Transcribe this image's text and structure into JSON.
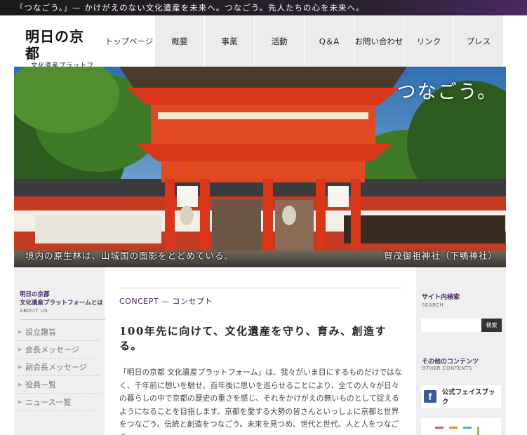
{
  "topbar": {
    "text": "「つなごう。」— かけがえのない文化遺産を未来へ。つなごう。先人たちの心を未来へ。"
  },
  "logo": {
    "main": "明日の京都",
    "sub": "文化遺産プラットフォーム"
  },
  "nav": {
    "home": "トップページ",
    "items": [
      "概要",
      "事業",
      "活動",
      "Q＆A",
      "お問い合わせ",
      "リンク",
      "プレス"
    ]
  },
  "hero": {
    "tagline": "つなごう。",
    "caption_left": "境内の原生林は、山城国の面影をとどめている。",
    "caption_right": "賀茂御祖神社（下鴨神社）"
  },
  "left_sidebar": {
    "title_line1": "明日の京都",
    "title_line2": "文化遺産プラットフォームとは",
    "subtitle": "ABOUT US",
    "items": [
      "設立趣旨",
      "会長メッセージ",
      "副会長メッセージ",
      "役員一覧",
      "ニュース一覧"
    ]
  },
  "main": {
    "section_label": "CONCEPT — コンセプト",
    "headline": "100年先に向けて、文化遺産を守り、育み、創造する。",
    "body": "「明日の京都 文化遺産プラットフォーム」は、我々がいま目にするものだけではなく、千年前に想いを馳せ、百年後に思いを巡らせることにより、全ての人々が日々の暮らしの中で京都の歴史の重さを感じ、それをかけがえの無いものとして捉えるようになることを目指します。京都を愛する大勢の皆さんといっしょに京都と世界をつなごう。伝統と創造をつなごう。未来を見つめ、世代と世代、人と人をつなごう。"
  },
  "right_sidebar": {
    "search_title": "サイト内検索",
    "search_sub": "SEARCH",
    "search_placeholder": "",
    "search_button": "検索",
    "contents_title": "その他のコンテンツ",
    "contents_sub": "OTHER CONTENTS",
    "facebook_label": "公式フェイスブック",
    "facebook_icon": "facebook-icon"
  },
  "colors": {
    "accent": "#4a2a63",
    "shrine_red": "#d9361a",
    "topbar_dark": "#1a1a1a"
  }
}
